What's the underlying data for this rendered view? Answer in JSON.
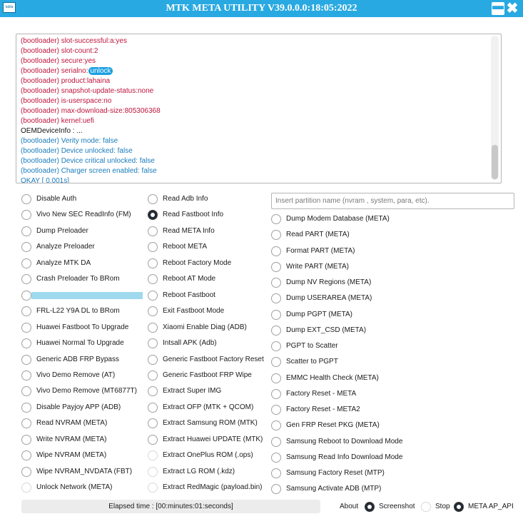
{
  "window": {
    "title": "MTK META UTILITY V39.0.0.0:18:05:2022",
    "icon_text": "tabla",
    "min_glyph": "▬",
    "close_glyph": "✖"
  },
  "log": [
    {
      "text": "(bootloader) slot-successful:a:yes",
      "color": "red"
    },
    {
      "text": "(bootloader) slot-count:2",
      "color": "red"
    },
    {
      "text": "(bootloader) secure:yes",
      "color": "red"
    },
    {
      "text": "(bootloader) serialno:",
      "mask": "unlock",
      "color": "red"
    },
    {
      "text": "(bootloader) product:lahaina",
      "color": "red"
    },
    {
      "text": "(bootloader) snapshot-update-status:none",
      "color": "red"
    },
    {
      "text": "(bootloader) is-userspace:no",
      "color": "red"
    },
    {
      "text": "(bootloader) max-download-size:805306368",
      "color": "red"
    },
    {
      "text": "(bootloader) kernel:uefi",
      "color": "red"
    },
    {
      "text": "OEMDeviceInfo   :   ...",
      "color": "black"
    },
    {
      "text": "(bootloader) Verity mode: false",
      "color": "blue"
    },
    {
      "text": "(bootloader) Device unlocked: false",
      "color": "blue"
    },
    {
      "text": "(bootloader) Device critical unlocked: false",
      "color": "blue"
    },
    {
      "text": "(bootloader) Charger screen enabled: false",
      "color": "blue"
    },
    {
      "text": "OKAY [  0.001s]",
      "color": "blue"
    }
  ],
  "col1": [
    {
      "label": "Disable Auth"
    },
    {
      "label": "Vivo New SEC ReadInfo (FM)"
    },
    {
      "label": "Dump Preloader"
    },
    {
      "label": "Analyze Preloader"
    },
    {
      "label": "Analyze MTK DA"
    },
    {
      "label": "Crash Preloader To BRom"
    },
    {
      "label": "",
      "redacted": true
    },
    {
      "label": "FRL-L22 Y9A DL to BRom"
    },
    {
      "label": "Huawei Fastboot To Upgrade"
    },
    {
      "label": "Huawei Normal To Upgrade"
    },
    {
      "label": "Generic ADB FRP Bypass"
    },
    {
      "label": "Vivo Demo Remove (AT)"
    },
    {
      "label": "Vivo Demo Remove (MT6877T)"
    },
    {
      "label": "Disable Payjoy APP (ADB)"
    },
    {
      "label": "Read NVRAM (META)"
    },
    {
      "label": "Write NVRAM (META)"
    },
    {
      "label": "Wipe NVRAM (META)"
    },
    {
      "label": "Wipe NVRAM_NVDATA (FBT)"
    },
    {
      "label": "Unlock Network (META)",
      "dim": true
    }
  ],
  "col2": [
    {
      "label": "Read Adb Info"
    },
    {
      "label": "Read Fastboot Info",
      "selected": true
    },
    {
      "label": "Read META Info"
    },
    {
      "label": "Reboot META"
    },
    {
      "label": "Reboot Factory Mode"
    },
    {
      "label": "Reboot AT Mode"
    },
    {
      "label": "Reboot Fastboot"
    },
    {
      "label": "Exit Fastboot Mode"
    },
    {
      "label": "Xiaomi Enable Diag (ADB)"
    },
    {
      "label": "Intsall APK (Adb)"
    },
    {
      "label": "Generic Fastboot Factory Reset"
    },
    {
      "label": "Generic Fastboot FRP Wipe"
    },
    {
      "label": "Extract Super IMG"
    },
    {
      "label": "Extract OFP (MTK + QCOM)"
    },
    {
      "label": "Extract Samsung ROM (MTK)"
    },
    {
      "label": "Extract Huawei UPDATE (MTK)"
    },
    {
      "label": "Extract OnePlus ROM (.ops)",
      "dim": true
    },
    {
      "label": "Extract LG ROM (.kdz)",
      "dim": true
    },
    {
      "label": "Extract RedMagic (payload.bin)",
      "dim": true
    }
  ],
  "partition": {
    "placeholder": "Insert partition name (nvram , system, para, etc)."
  },
  "col3": [
    {
      "label": "Dump Modem Database (META)"
    },
    {
      "label": "Read PART (META)"
    },
    {
      "label": "Format PART (META)"
    },
    {
      "label": "Write PART (META)"
    },
    {
      "label": "Dump NV Regions (META)"
    },
    {
      "label": "Dump USERAREA (META)"
    },
    {
      "label": "Dump PGPT (META)"
    },
    {
      "label": "Dump  EXT_CSD (META)"
    },
    {
      "label": "PGPT to Scatter"
    },
    {
      "label": "Scatter to PGPT"
    },
    {
      "label": "EMMC Health Check (META)"
    },
    {
      "label": "Factory Reset - META"
    },
    {
      "label": "Factory Reset - META2"
    },
    {
      "label": "Gen FRP Reset PKG (META)"
    },
    {
      "label": "Samsung Reboot to Download Mode"
    },
    {
      "label": "Samsung Read Info Download Mode"
    },
    {
      "label": "Samsung Factory Reset (MTP)"
    },
    {
      "label": "Samsung Activate ADB (MTP)"
    }
  ],
  "footer": {
    "elapsed": "Elapsed time : [00:minutes:01:seconds]",
    "about": "About",
    "options": [
      {
        "label": "Screenshot",
        "selected": true
      },
      {
        "label": "Stop",
        "selected": false,
        "dim": true
      },
      {
        "label": "META AP_API",
        "selected": true
      }
    ]
  }
}
